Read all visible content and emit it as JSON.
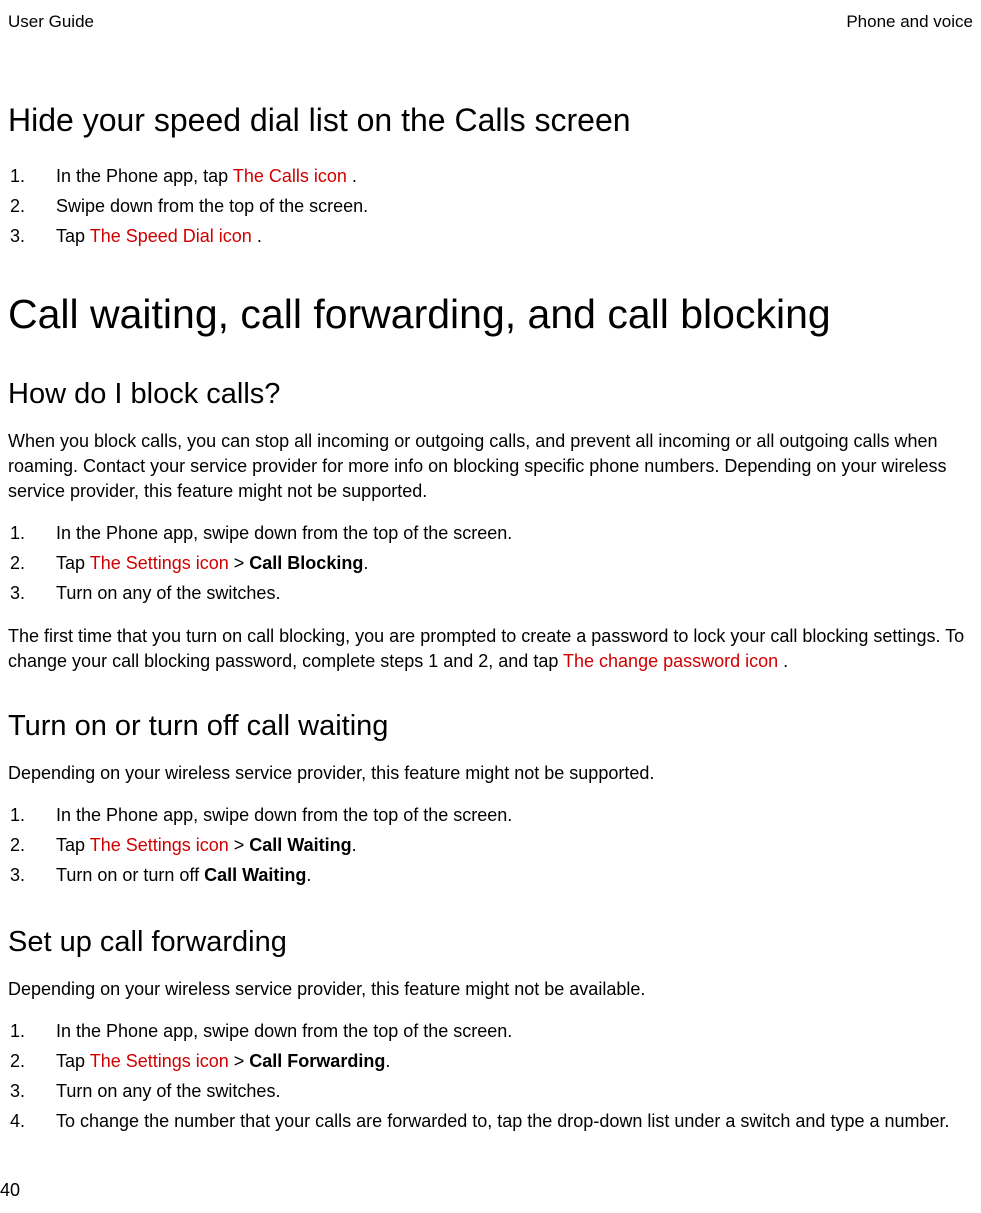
{
  "header": {
    "left": "User Guide",
    "right": "Phone and voice"
  },
  "section1": {
    "title": "Hide your speed dial list on the Calls screen",
    "steps": [
      {
        "num": "1.",
        "prefix": "In the Phone app, tap ",
        "red": "The Calls icon",
        "suffix": " ."
      },
      {
        "num": "2.",
        "prefix": "Swipe down from the top of the screen.",
        "red": "",
        "suffix": ""
      },
      {
        "num": "3.",
        "prefix": "Tap ",
        "red": "The Speed Dial icon",
        "suffix": " ."
      }
    ]
  },
  "h1": "Call waiting, call forwarding, and call blocking",
  "section2": {
    "title": "How do I block calls?",
    "intro": "When you block calls, you can stop all incoming or outgoing calls, and prevent all incoming or all outgoing calls when roaming. Contact your service provider for more info on blocking specific phone numbers. Depending on your wireless service provider, this feature might not be supported.",
    "steps": [
      {
        "num": "1.",
        "text": "In the Phone app, swipe down from the top of the screen."
      },
      {
        "num": "2.",
        "prefix": "Tap ",
        "red": "The Settings icon",
        "mid": "  > ",
        "bold": "Call Blocking",
        "suffix": "."
      },
      {
        "num": "3.",
        "text": "Turn on any of the switches."
      }
    ],
    "outro_prefix": "The first time that you turn on call blocking, you are prompted to create a password to lock your call blocking settings. To change your call blocking password, complete steps 1 and 2, and tap ",
    "outro_red": "The change password icon",
    "outro_suffix": " ."
  },
  "section3": {
    "title": "Turn on or turn off call waiting",
    "intro": "Depending on your wireless service provider, this feature might not be supported.",
    "steps": [
      {
        "num": "1.",
        "text": "In the Phone app, swipe down from the top of the screen."
      },
      {
        "num": "2.",
        "prefix": "Tap ",
        "red": "The Settings icon",
        "mid": "  > ",
        "bold": "Call Waiting",
        "suffix": "."
      },
      {
        "num": "3.",
        "prefix": "Turn on or turn off ",
        "bold": "Call Waiting",
        "suffix": "."
      }
    ]
  },
  "section4": {
    "title": "Set up call forwarding",
    "intro": "Depending on your wireless service provider, this feature might not be available.",
    "steps": [
      {
        "num": "1.",
        "text": "In the Phone app, swipe down from the top of the screen."
      },
      {
        "num": "2.",
        "prefix": "Tap ",
        "red": "The Settings icon",
        "mid": "  > ",
        "bold": "Call Forwarding",
        "suffix": "."
      },
      {
        "num": "3.",
        "text": "Turn on any of the switches."
      },
      {
        "num": "4.",
        "text": "To change the number that your calls are forwarded to, tap the drop-down list under a switch and type a number."
      }
    ]
  },
  "pageNum": "40"
}
